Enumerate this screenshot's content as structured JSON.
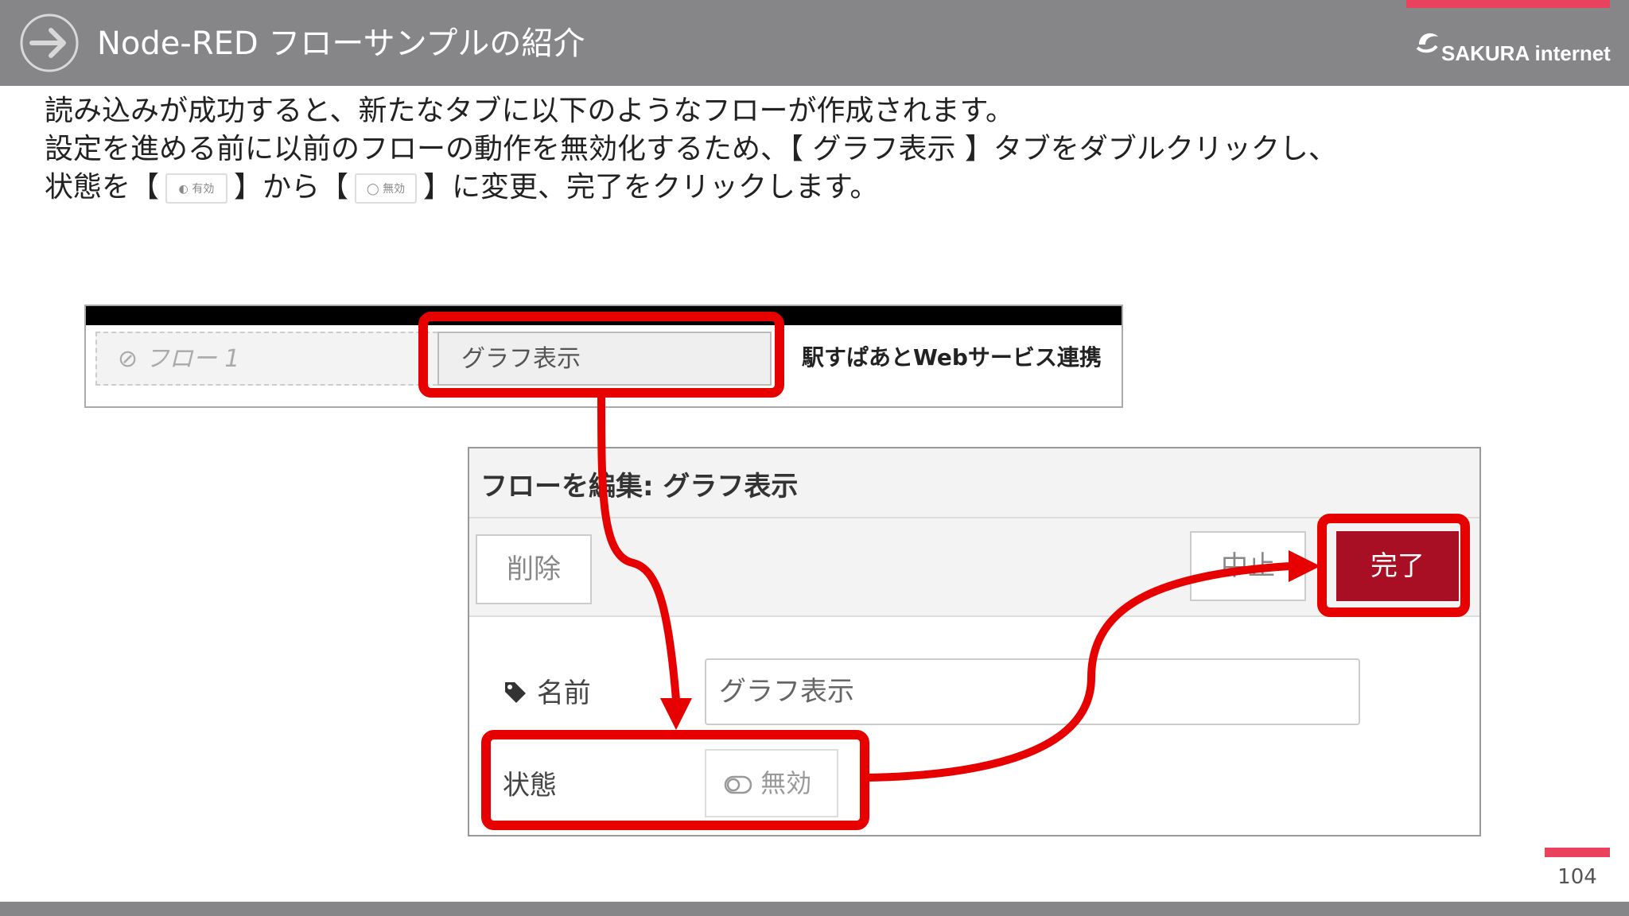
{
  "header": {
    "title": "Node-RED フローサンプルの紹介",
    "brand": "SAKURA internet",
    "accent_color": "#e8425e"
  },
  "body": {
    "line1": "読み込みが成功すると、新たなタブに以下のようなフローが作成されます。",
    "line2": "設定を進める前に以前のフローの動作を無効化するため、【 グラフ表示 】タブをダブルクリックし、",
    "line3_a": "状態を【",
    "toggle_enabled": "有効",
    "line3_b": "】から【",
    "toggle_disabled": "無効",
    "line3_c": "】に変更、完了をクリックします。"
  },
  "tabs": [
    {
      "label": "フロー 1",
      "icon": "disabled-icon"
    },
    {
      "label": "グラフ表示"
    },
    {
      "label": "駅すぱあとWebサービス連携"
    }
  ],
  "dialog": {
    "title": "フローを編集: グラフ表示",
    "delete_label": "削除",
    "cancel_label": "中止",
    "done_label": "完了",
    "done_color": "#a80f24",
    "name_label": "名前",
    "name_value": "グラフ表示",
    "status_label": "状態",
    "status_value": "無効"
  },
  "highlight_color": "#e60000",
  "page_number": "104"
}
